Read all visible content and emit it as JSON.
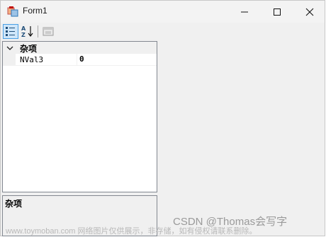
{
  "window": {
    "title": "Form1"
  },
  "toolbar": {
    "categorized_icon": "categorized-view-icon",
    "alphabetical_icon": "alphabetical-sort-icon",
    "property_pages_icon": "property-pages-icon",
    "categorized_active": true
  },
  "property_grid": {
    "category": {
      "label": "杂项",
      "expanded": true
    },
    "properties": [
      {
        "name": "NVal3",
        "value": "0"
      }
    ]
  },
  "help": {
    "title": "杂项"
  },
  "overlay": {
    "watermark": "www.toymoban.com 网络图片仅供展示，非存储，如有侵权请联系删除。",
    "credit": "CSDN @Thomas会写字"
  },
  "colors": {
    "selected_button_bg": "#cfe6f9",
    "selected_button_border": "#4aa0e6",
    "window_bg": "#f0f0f0"
  }
}
